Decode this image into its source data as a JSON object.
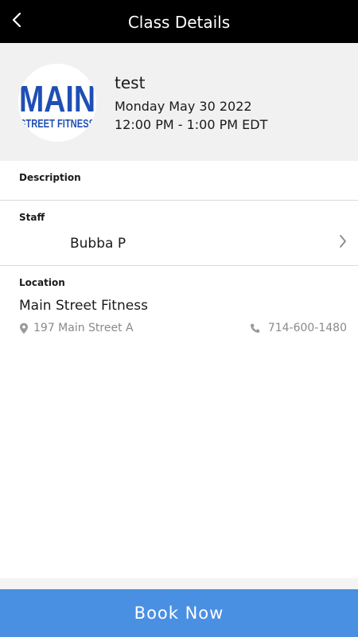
{
  "header": {
    "title": "Class Details",
    "back_icon": "chevron-left-icon"
  },
  "class": {
    "title": "test",
    "date": "Monday May 30 2022",
    "time": "12:00 PM - 1:00 PM EDT",
    "logo_line1": "MAIN",
    "logo_line2": "STREET FITNESS"
  },
  "sections": {
    "description_label": "Description",
    "staff_label": "Staff",
    "location_label": "Location"
  },
  "staff": {
    "name": "Bubba P"
  },
  "location": {
    "name": "Main Street Fitness",
    "address": "197 Main Street A",
    "phone": "714-600-1480"
  },
  "actions": {
    "book_label": "Book Now"
  },
  "colors": {
    "header_bg": "#000000",
    "summary_bg": "#f1f1f1",
    "book_button_bg": "#4a90e2",
    "logo_blue": "#1f4fb4",
    "muted_text": "#8a8a8a"
  }
}
